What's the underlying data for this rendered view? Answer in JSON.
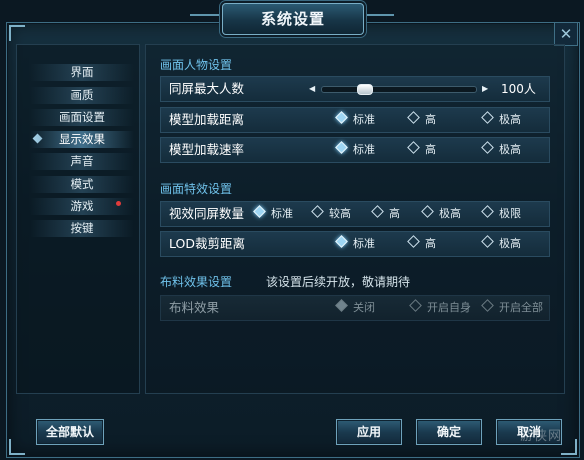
{
  "window": {
    "title": "系统设置",
    "close_glyph": "✕"
  },
  "nav": {
    "items": [
      {
        "label": "界面"
      },
      {
        "label": "画质"
      },
      {
        "label": "画面设置"
      },
      {
        "label": "显示效果",
        "active": true
      },
      {
        "label": "声音"
      },
      {
        "label": "模式"
      },
      {
        "label": "游戏",
        "notification": true
      },
      {
        "label": "按键"
      }
    ]
  },
  "sections": {
    "character": {
      "title": "画面人物设置",
      "max_players": {
        "label": "同屏最大人数",
        "value": "100人",
        "slider_level": 0.25,
        "left_arrow": "◀",
        "right_arrow": "▶"
      },
      "model_load_distance": {
        "label": "模型加载距离",
        "options": [
          "标准",
          "高",
          "极高"
        ],
        "selected": "标准"
      },
      "model_load_speed": {
        "label": "模型加载速率",
        "options": [
          "标准",
          "高",
          "极高"
        ],
        "selected": "标准"
      }
    },
    "effects": {
      "title": "画面特效设置",
      "effect_count": {
        "label": "视效同屏数量",
        "options": [
          "标准",
          "较高",
          "高",
          "极高",
          "极限"
        ],
        "selected": "标准"
      },
      "lod_distance": {
        "label": "LOD裁剪距离",
        "options": [
          "标准",
          "高",
          "极高"
        ],
        "selected": "标准"
      }
    },
    "cloth": {
      "title": "布料效果设置",
      "note": "该设置后续开放，敬请期待",
      "cloth_effect": {
        "label": "布料效果",
        "options": [
          "关闭",
          "开启自身",
          "开启全部"
        ],
        "selected": "关闭",
        "disabled": true
      }
    }
  },
  "buttons": {
    "reset_all": "全部默认",
    "apply": "应用",
    "confirm": "确定",
    "cancel": "取消"
  },
  "watermark": "游侠网",
  "colors": {
    "accent": "#6fc1ea",
    "background": "#0b1822",
    "notification": "#e03b3b"
  }
}
